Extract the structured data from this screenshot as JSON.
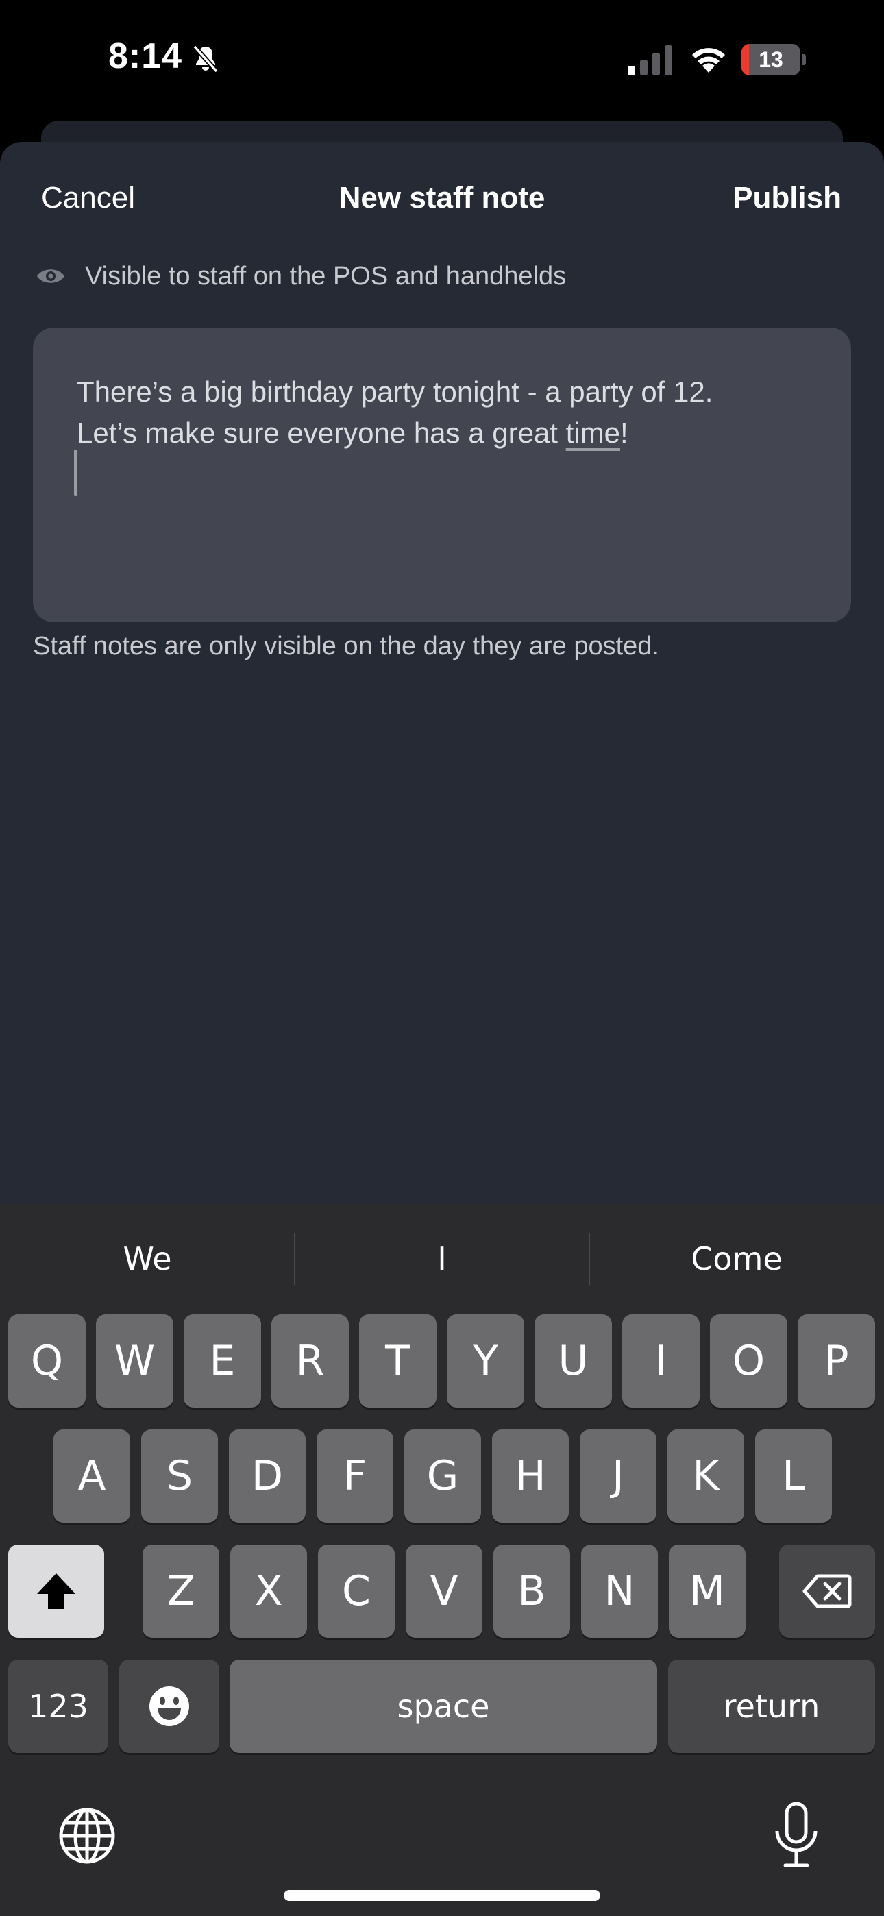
{
  "status_bar": {
    "time": "8:14",
    "battery_level": "13",
    "battery_fill_fraction": 0.13,
    "icons": [
      "bell-slash-icon",
      "cellular-signal-icon",
      "wifi-icon",
      "battery-icon"
    ]
  },
  "nav": {
    "cancel_label": "Cancel",
    "title": "New staff note",
    "publish_label": "Publish"
  },
  "visibility": {
    "icon": "eye-icon",
    "text": "Visible to staff on the POS and handhelds"
  },
  "note": {
    "line1": "There’s a big birthday party tonight - a party of 12.",
    "line2_prefix": "Let’s make sure everyone has a great ",
    "line2_underlined": "time",
    "line2_suffix": "!"
  },
  "helper_text": "Staff notes are only visible on the day they are posted.",
  "keyboard": {
    "suggestions": [
      "We",
      "I",
      "Come"
    ],
    "row1": [
      "Q",
      "W",
      "E",
      "R",
      "T",
      "Y",
      "U",
      "I",
      "O",
      "P"
    ],
    "row2": [
      "A",
      "S",
      "D",
      "F",
      "G",
      "H",
      "J",
      "K",
      "L"
    ],
    "row3": [
      "Z",
      "X",
      "C",
      "V",
      "B",
      "N",
      "M"
    ],
    "numbers_label": "123",
    "space_label": "space",
    "return_label": "return",
    "icons": [
      "shift-icon",
      "backspace-icon",
      "emoji-icon",
      "globe-icon",
      "microphone-icon"
    ]
  },
  "colors": {
    "sheet_background": "#262a35",
    "note_field_background": "#434550",
    "keyboard_background": "#2b2b2d",
    "battery_low": "#eb3b30"
  }
}
